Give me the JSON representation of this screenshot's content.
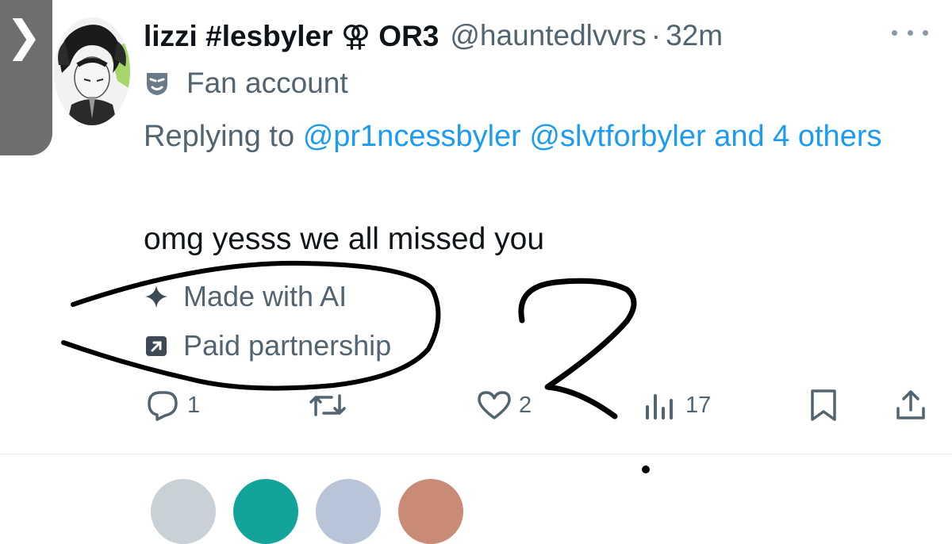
{
  "tweet": {
    "display_name": "lizzi #lesbyler ⚢ OR3",
    "handle": "@hauntedlvvrs",
    "separator": "·",
    "time": "32m",
    "account_label": "Fan account",
    "replying_prefix": "Replying to",
    "replying_users": "@pr1ncessbyler @slvtforbyler and 4 others",
    "text": "omg yesss we all missed you",
    "made_with_ai": "Made with AI",
    "paid_partnership": "Paid partnership"
  },
  "actions": {
    "replies": "1",
    "likes": "2",
    "views": "17"
  },
  "side_tab": {
    "glyph": "❯"
  },
  "icons": {
    "label": "mask-icon",
    "ai": "sparkle-icon",
    "paid": "arrow-out-icon",
    "reply": "reply-icon",
    "retweet": "retweet-icon",
    "like": "heart-icon",
    "views": "views-icon",
    "bookmark": "bookmark-icon",
    "share": "share-icon",
    "more": "more-dots-icon"
  },
  "colors": {
    "link": "#1d9bf0",
    "secondary_text": "#536471",
    "primary_text": "#0f1419",
    "scribble": "#000000"
  }
}
